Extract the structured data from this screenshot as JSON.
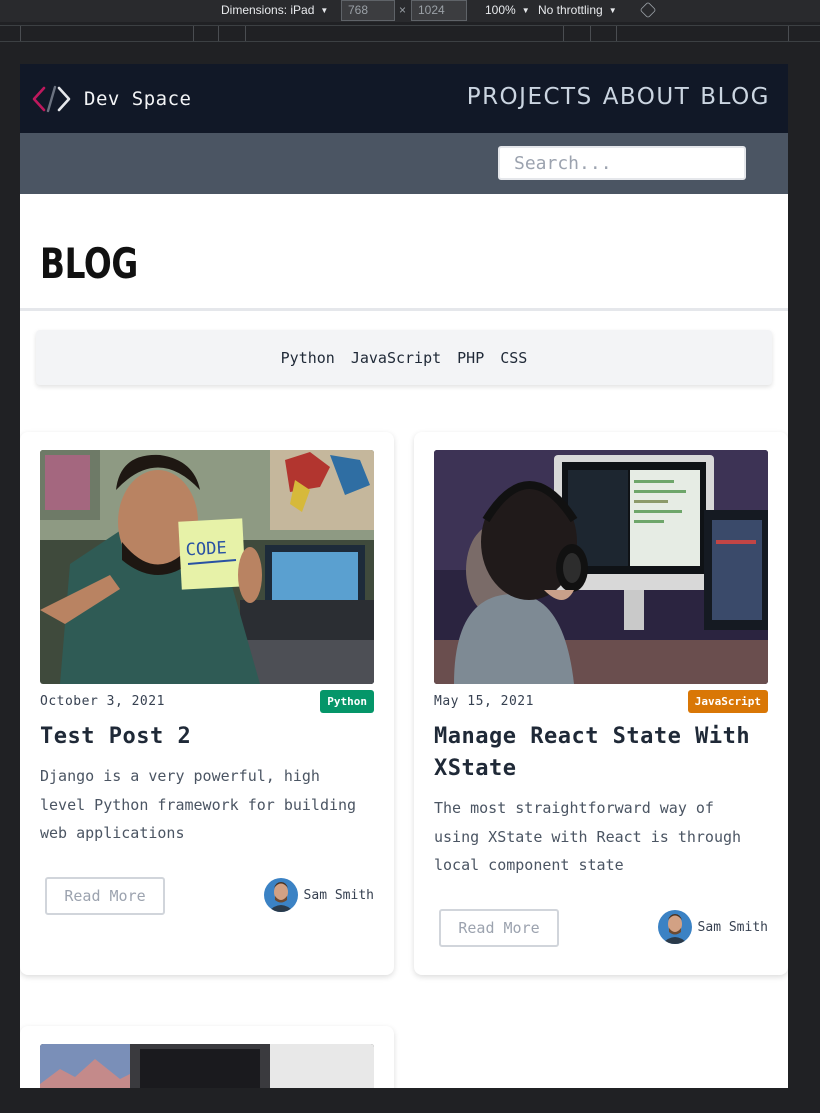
{
  "devtools": {
    "dimensions_label": "Dimensions: iPad",
    "width": "768",
    "height": "1024",
    "times": "×",
    "zoom": "100%",
    "throttling": "No throttling"
  },
  "nav": {
    "logo_text": "Dev Space",
    "links": [
      "PROJECTS",
      "ABOUT",
      "BLOG"
    ]
  },
  "search": {
    "placeholder": "Search..."
  },
  "page": {
    "title": "BLOG"
  },
  "tag_filter": [
    "Python",
    "JavaScript",
    "PHP",
    "CSS"
  ],
  "posts": [
    {
      "date": "October 3, 2021",
      "category": "Python",
      "category_color": "#059669",
      "title": "Test Post 2",
      "description": "Django is a very powerful, high level Python framework for building web applications",
      "read_more": "Read More",
      "author": "Sam Smith"
    },
    {
      "date": "May 15, 2021",
      "category": "JavaScript",
      "category_color": "#d97706",
      "title": "Manage React State With XState",
      "description": "The most straightforward way of using XState with React is through local component state",
      "read_more": "Read More",
      "author": "Sam Smith"
    }
  ],
  "colors": {
    "nav_bg": "#111827",
    "search_bar_bg": "#4b5563",
    "python_badge": "#059669",
    "javascript_badge": "#d97706"
  }
}
